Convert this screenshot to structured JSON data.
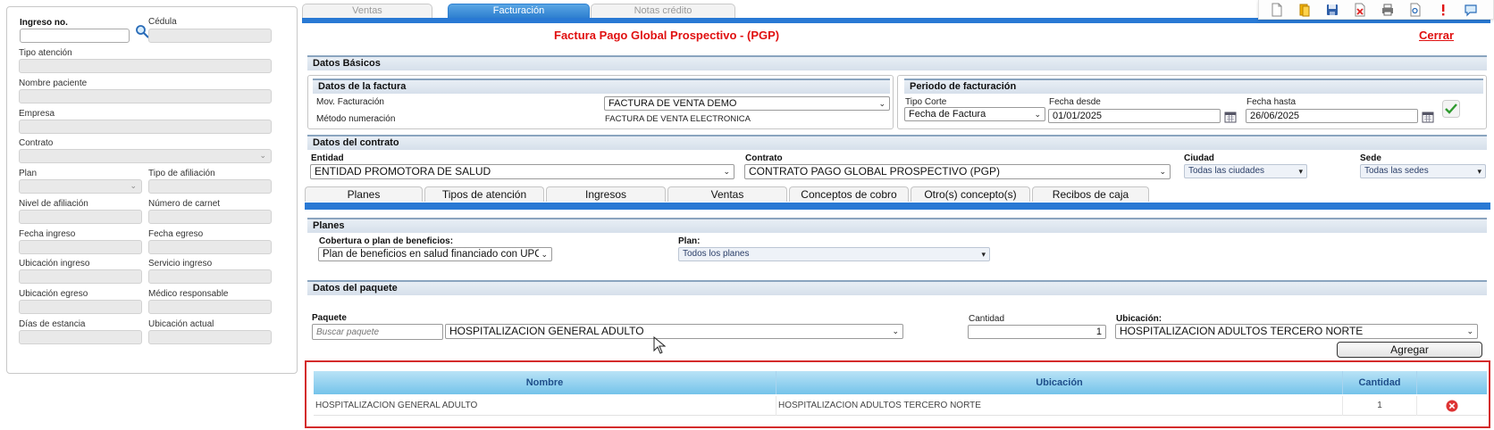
{
  "left_panel": {
    "ingreso_label": "Ingreso no.",
    "cedula_label": "Cédula",
    "tipo_atencion_label": "Tipo atención",
    "nombre_paciente_label": "Nombre paciente",
    "empresa_label": "Empresa",
    "contrato_label": "Contrato",
    "plan_label": "Plan",
    "tipo_afiliacion_label": "Tipo de afiliación",
    "nivel_afiliacion_label": "Nivel de afiliación",
    "numero_carnet_label": "Número de carnet",
    "fecha_ingreso_label": "Fecha ingreso",
    "fecha_egreso_label": "Fecha egreso",
    "ubicacion_ingreso_label": "Ubicación ingreso",
    "servicio_ingreso_label": "Servicio ingreso",
    "ubicacion_egreso_label": "Ubicación egreso",
    "medico_responsable_label": "Médico responsable",
    "dias_estancia_label": "Días de estancia",
    "ubicacion_actual_label": "Ubicación actual"
  },
  "top_tabs": [
    "Ventas",
    "Facturación",
    "Notas crédito"
  ],
  "active_tab": "Facturación",
  "toolbar_icons": [
    "new-document-icon",
    "folder-icon",
    "save-icon",
    "delete-document-icon",
    "print-icon",
    "preview-icon",
    "alert-icon",
    "chat-icon"
  ],
  "page_title": "Factura Pago Global Prospectivo - (PGP)",
  "close_label": "Cerrar",
  "datos_basicos": {
    "title": "Datos Básicos",
    "datos_factura": {
      "title": "Datos de la factura",
      "mov_label": "Mov. Facturación",
      "mov_value": "FACTURA DE VENTA DEMO",
      "metodo_label": "Método numeración",
      "metodo_value": "FACTURA DE VENTA ELECTRONICA"
    },
    "periodo": {
      "title": "Periodo de facturación",
      "tipo_corte_label": "Tipo Corte",
      "tipo_corte_value": "Fecha de Factura",
      "fecha_desde_label": "Fecha desde",
      "fecha_desde_value": "01/01/2025",
      "fecha_hasta_label": "Fecha hasta",
      "fecha_hasta_value": "26/06/2025"
    }
  },
  "datos_contrato": {
    "title": "Datos del contrato",
    "entidad_label": "Entidad",
    "entidad_value": "ENTIDAD PROMOTORA DE SALUD",
    "contrato_label": "Contrato",
    "contrato_value": "CONTRATO PAGO GLOBAL PROSPECTIVO (PGP)",
    "ciudad_label": "Ciudad",
    "ciudad_value": "Todas las ciudades",
    "sede_label": "Sede",
    "sede_value": "Todas las sedes"
  },
  "sub_tabs": [
    "Planes",
    "Tipos de atención",
    "Ingresos",
    "Ventas",
    "Conceptos de cobro",
    "Otro(s) concepto(s)",
    "Recibos de caja"
  ],
  "planes": {
    "title": "Planes",
    "cobertura_label": "Cobertura o plan de beneficios:",
    "cobertura_value": "Plan de beneficios en salud financiado con UPC",
    "plan_label": "Plan:",
    "plan_value": "Todos los planes"
  },
  "paquete": {
    "title": "Datos del paquete",
    "paquete_label": "Paquete",
    "buscar_placeholder": "Buscar paquete",
    "paquete_value": "HOSPITALIZACION GENERAL ADULTO",
    "cantidad_label": "Cantidad",
    "cantidad_value": "1",
    "ubicacion_label": "Ubicación:",
    "ubicacion_value": "HOSPITALIZACION ADULTOS TERCERO NORTE",
    "agregar_label": "Agregar"
  },
  "table": {
    "headers": [
      "Nombre",
      "Ubicación",
      "Cantidad"
    ],
    "rows": [
      {
        "nombre": "HOSPITALIZACION GENERAL ADULTO",
        "ubicacion": "HOSPITALIZACION ADULTOS TERCERO NORTE",
        "cantidad": "1"
      }
    ]
  },
  "colors": {
    "accent_blue": "#2979d4",
    "title_red": "#e01010",
    "highlight_red": "#d42b2b",
    "table_header": "#74c3ea"
  }
}
